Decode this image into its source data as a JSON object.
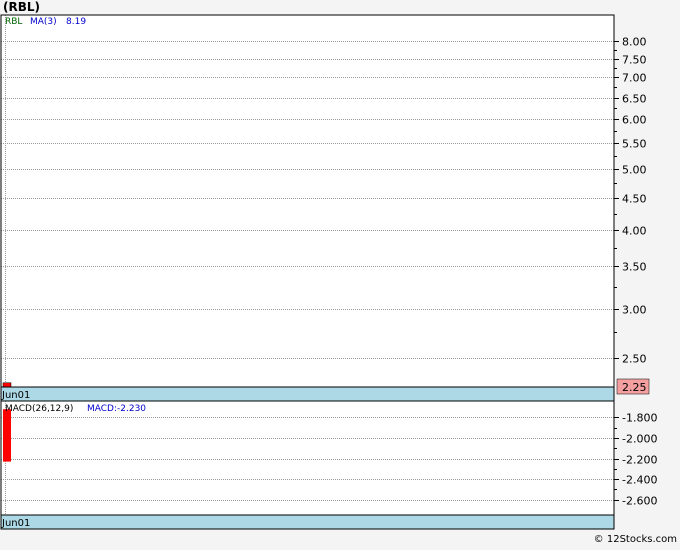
{
  "ticker_title": "(RBL)",
  "copyright": "© 12Stocks.com",
  "colors": {
    "background": "#f4f4f4",
    "panel": "#ffffff",
    "grid": "#9a9a9a",
    "date_bar": "#add8e6",
    "price_label_bg": "#f4a0a0",
    "candle": "#ff0000",
    "ticker_text": "#006400",
    "ma_text": "#0000cc"
  },
  "chart_data": [
    {
      "type": "candlestick",
      "panel": "price",
      "legend": {
        "ticker": "RBL",
        "ma_label": "MA(3)",
        "ma_value": "8.19"
      },
      "x": [
        "Jun01"
      ],
      "candles": [
        {
          "x": "Jun01",
          "open": 2.26,
          "close": 2.25,
          "high": 2.26,
          "low": 2.25
        }
      ],
      "last_price_label": "2.25",
      "y_scale": "log",
      "ylim": [
        2.25,
        8.8
      ],
      "yticks": [
        8.0,
        7.5,
        7.0,
        6.5,
        6.0,
        5.5,
        5.0,
        4.5,
        4.0,
        3.5,
        3.0,
        2.5
      ],
      "ytick_labels": [
        "8.00",
        "7.50",
        "7.00",
        "6.50",
        "6.00",
        "5.50",
        "5.00",
        "4.50",
        "4.00",
        "3.50",
        "3.00",
        "2.50"
      ],
      "grid": true,
      "date_label": "Jun01"
    },
    {
      "type": "bar",
      "panel": "macd",
      "legend": {
        "label": "MACD(26,12,9)",
        "value_label": "MACD:-2.230"
      },
      "x": [
        "Jun01"
      ],
      "bars": [
        {
          "x": "Jun01",
          "top": -1.72,
          "bottom": -2.23
        }
      ],
      "ylim": [
        -2.75,
        -1.64
      ],
      "yticks": [
        -1.8,
        -2.0,
        -2.2,
        -2.4,
        -2.6
      ],
      "ytick_labels": [
        "-1.800",
        "-2.000",
        "-2.200",
        "-2.400",
        "-2.600"
      ],
      "grid": true,
      "date_label": "Jun01"
    }
  ]
}
